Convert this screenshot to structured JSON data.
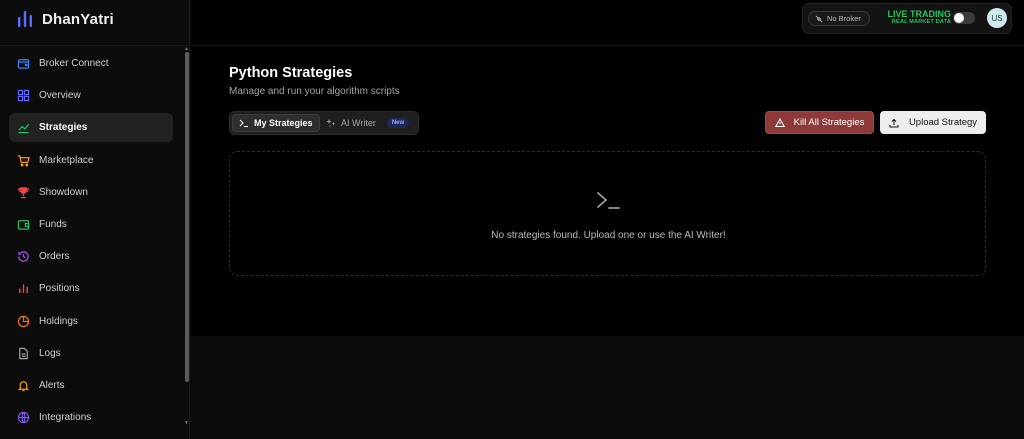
{
  "brand": {
    "name": "DhanYatri"
  },
  "sidebar": {
    "items": [
      {
        "label": "Broker Connect",
        "icon": "wallet-icon",
        "color": "#3b82f6",
        "active": false
      },
      {
        "label": "Overview",
        "icon": "grid-icon",
        "color": "#6366f1",
        "active": false
      },
      {
        "label": "Strategies",
        "icon": "trend-icon",
        "color": "#22c55e",
        "active": true
      },
      {
        "label": "Marketplace",
        "icon": "cart-icon",
        "color": "#f59e0b",
        "active": false
      },
      {
        "label": "Showdown",
        "icon": "trophy-icon",
        "color": "#ef4444",
        "active": false
      },
      {
        "label": "Funds",
        "icon": "wallet-icon",
        "color": "#22c55e",
        "active": false
      },
      {
        "label": "Orders",
        "icon": "history-icon",
        "color": "#a855f7",
        "active": false
      },
      {
        "label": "Positions",
        "icon": "bar-chart-icon",
        "color": "#ef4444",
        "active": false
      },
      {
        "label": "Holdings",
        "icon": "pie-icon",
        "color": "#f97316",
        "active": false
      },
      {
        "label": "Logs",
        "icon": "file-icon",
        "color": "#a3a3a3",
        "active": false
      },
      {
        "label": "Alerts",
        "icon": "bell-icon",
        "color": "#f59e0b",
        "active": false
      },
      {
        "label": "Integrations",
        "icon": "globe-icon",
        "color": "#8b5cf6",
        "active": false
      }
    ]
  },
  "topbar": {
    "broker_label": "No Broker",
    "live_title": "LIVE TRADING",
    "live_subtitle": "REAL MARKET DATA",
    "live_color": "#22c55e",
    "avatar_initials": "US"
  },
  "main": {
    "title": "Python Strategies",
    "subtitle": "Manage and run your algorithm scripts",
    "tabs": [
      {
        "label": "My Strategies",
        "icon": "terminal-icon",
        "active": true
      },
      {
        "label": "AI Writer",
        "icon": "sparkles-icon",
        "active": false,
        "badge": "New"
      }
    ],
    "kill_button": "Kill All Strategies",
    "upload_button": "Upload Strategy",
    "empty_message": "No strategies found. Upload one or use the AI Writer!"
  },
  "colors": {
    "danger": "#8f3a3a",
    "accent_green": "#22c55e",
    "badge_bg": "#1e2a55"
  }
}
